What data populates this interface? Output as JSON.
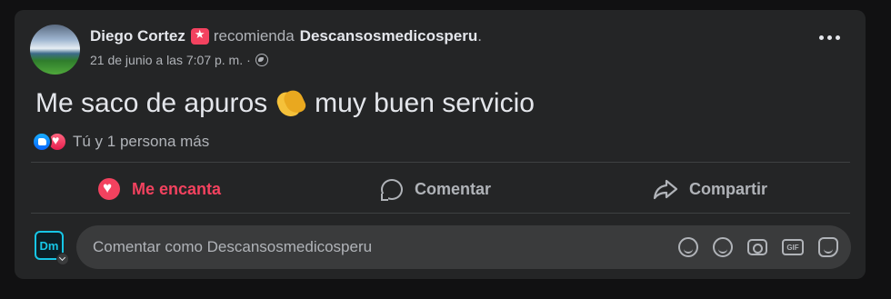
{
  "post": {
    "author": "Diego Cortez",
    "recommends": "recomienda",
    "page": "Descansosmedicosperu",
    "page_suffix": ".",
    "timestamp": "21 de junio a las 7:07 p. m.",
    "separator": "·",
    "audience_icon": "globe-icon",
    "text_before": "Me saco de apuros",
    "emoji": "clapping-hands",
    "text_after": "muy buen servicio",
    "reactions": {
      "icons": [
        "like",
        "love"
      ],
      "summary": "Tú y 1 persona más"
    }
  },
  "actions": {
    "love_label": "Me encanta",
    "comment_label": "Comentar",
    "share_label": "Compartir"
  },
  "composer": {
    "avatar_text": "Dm",
    "placeholder": "Comentar como Descansosmedicosperu",
    "icons": [
      "avatar-sticker-icon",
      "emoji-icon",
      "camera-icon",
      "gif-icon",
      "sticker-icon"
    ],
    "gif_text": "GIF"
  },
  "colors": {
    "background": "#111112",
    "card": "#242526",
    "love": "#f3425f",
    "accent_cyan": "#17c6e6"
  }
}
